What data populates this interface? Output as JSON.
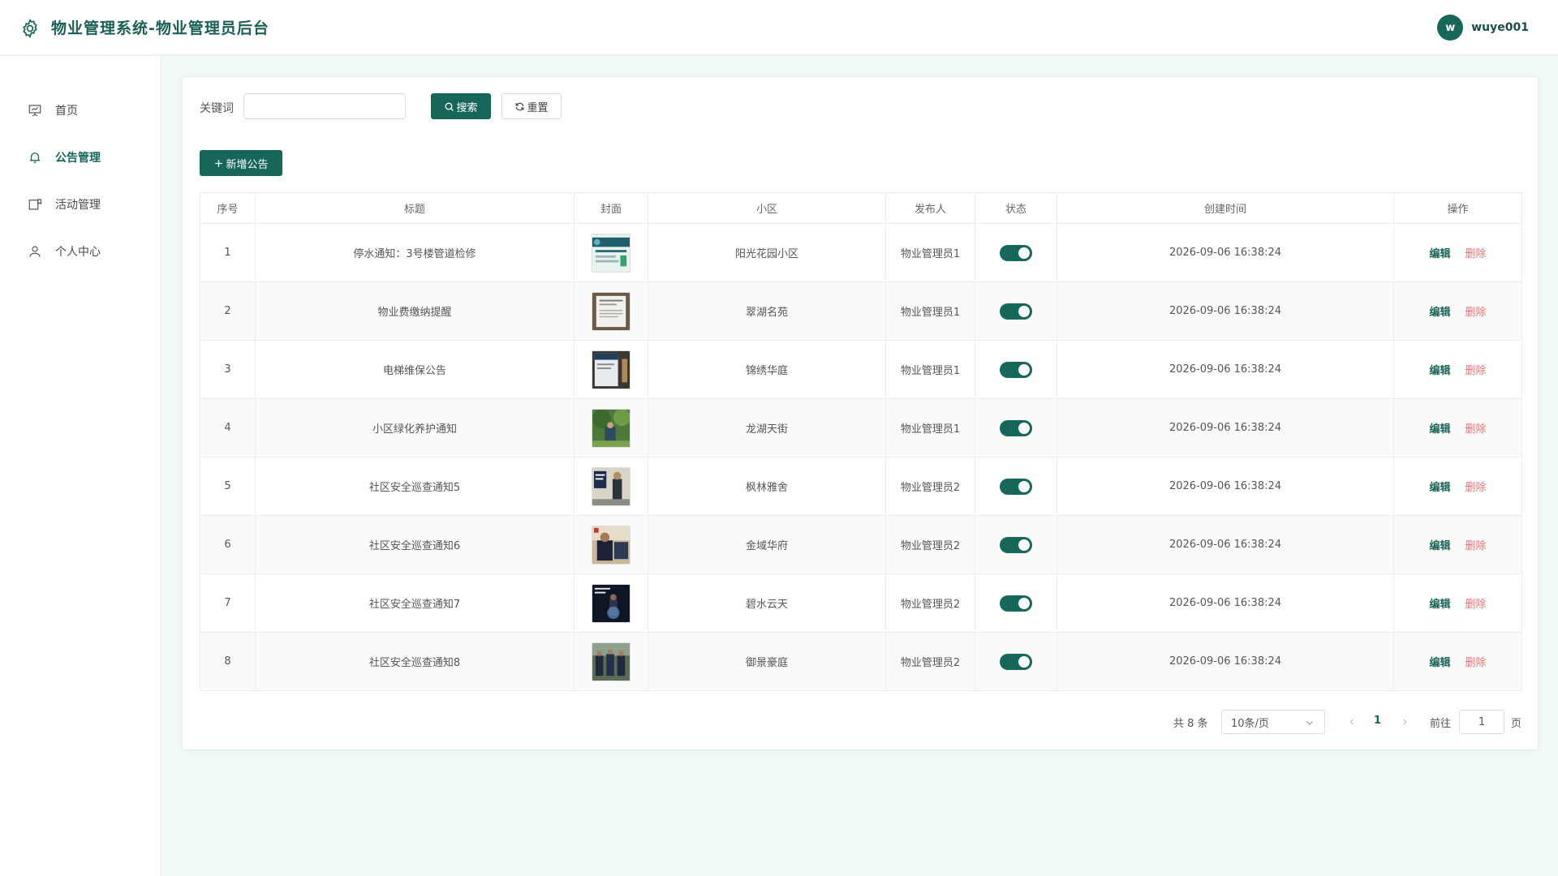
{
  "header": {
    "title": "物业管理系统-物业管理员后台",
    "avatar_letter": "w",
    "username": "wuye001"
  },
  "sidebar": {
    "items": [
      {
        "label": "首页",
        "icon": "presentation-board-icon",
        "active": false
      },
      {
        "label": "公告管理",
        "icon": "bell-icon",
        "active": true
      },
      {
        "label": "活动管理",
        "icon": "calendar-flag-icon",
        "active": false
      },
      {
        "label": "个人中心",
        "icon": "user-icon",
        "active": false
      }
    ]
  },
  "search": {
    "keyword_label": "关键词",
    "keyword_value": "",
    "keyword_placeholder": "",
    "search_label": "搜索",
    "reset_label": "重置",
    "add_label": "新增公告"
  },
  "table": {
    "headers": [
      "序号",
      "标题",
      "封面",
      "小区",
      "发布人",
      "状态",
      "创建时间",
      "操作"
    ],
    "rows": [
      {
        "no": "1",
        "title": "停水通知：3号楼管道检修",
        "community": "阳光花园小区",
        "publisher": "物业管理员1",
        "status": true,
        "created": "2026-09-06 16:38:24"
      },
      {
        "no": "2",
        "title": "物业费缴纳提醒",
        "community": "翠湖名苑",
        "publisher": "物业管理员1",
        "status": true,
        "created": "2026-09-06 16:38:24"
      },
      {
        "no": "3",
        "title": "电梯维保公告",
        "community": "锦绣华庭",
        "publisher": "物业管理员1",
        "status": true,
        "created": "2026-09-06 16:38:24"
      },
      {
        "no": "4",
        "title": "小区绿化养护通知",
        "community": "龙湖天街",
        "publisher": "物业管理员1",
        "status": true,
        "created": "2026-09-06 16:38:24"
      },
      {
        "no": "5",
        "title": "社区安全巡查通知5",
        "community": "枫林雅舍",
        "publisher": "物业管理员2",
        "status": true,
        "created": "2026-09-06 16:38:24"
      },
      {
        "no": "6",
        "title": "社区安全巡查通知6",
        "community": "金域华府",
        "publisher": "物业管理员2",
        "status": true,
        "created": "2026-09-06 16:38:24"
      },
      {
        "no": "7",
        "title": "社区安全巡查通知7",
        "community": "碧水云天",
        "publisher": "物业管理员2",
        "status": true,
        "created": "2026-09-06 16:38:24"
      },
      {
        "no": "8",
        "title": "社区安全巡查通知8",
        "community": "御景豪庭",
        "publisher": "物业管理员2",
        "status": true,
        "created": "2026-09-06 16:38:24"
      }
    ],
    "edit_label": "编辑",
    "delete_label": "删除"
  },
  "pagination": {
    "total_text": "共 8 条",
    "page_size": "10条/页",
    "current_page": "1",
    "goto_prefix": "前往",
    "goto_value": "1",
    "goto_suffix": "页"
  },
  "colors": {
    "primary": "#17665a",
    "danger": "#f56c6c",
    "background": "#f2faf8"
  }
}
